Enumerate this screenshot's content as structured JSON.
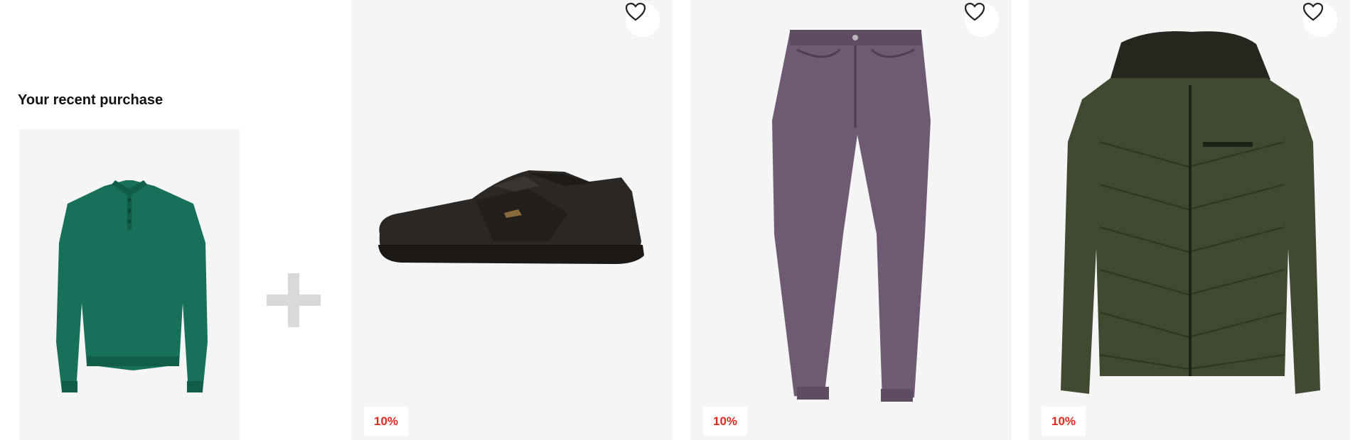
{
  "recent_purchase": {
    "heading": "Your recent purchase",
    "item": {
      "name": "green-polo-sweater",
      "image_icon": "sweater-image"
    }
  },
  "bundle": {
    "plus_icon": "plus-icon",
    "products": [
      {
        "image_icon": "sneaker-image",
        "discount": "10%",
        "wishlist_icon": "heart-icon"
      },
      {
        "image_icon": "jeans-image",
        "discount": "10%",
        "wishlist_icon": "heart-icon"
      },
      {
        "image_icon": "puffer-jacket-image",
        "discount": "10%",
        "wishlist_icon": "heart-icon"
      }
    ]
  },
  "colors": {
    "card_bg": "#f5f5f5",
    "discount_text": "#e0281d",
    "sweater": "#17705a",
    "sneaker": "#2b2724",
    "jeans": "#6e5a73",
    "jacket": "#3f4a30"
  }
}
